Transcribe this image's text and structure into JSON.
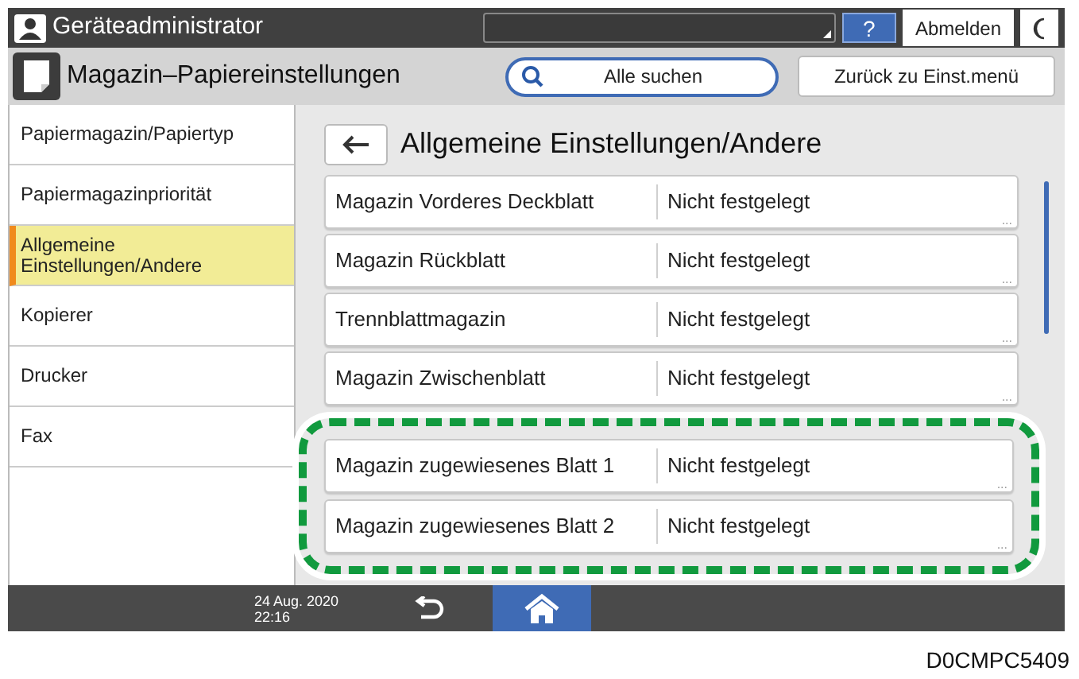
{
  "top_bar": {
    "user": "Geräteadministrator",
    "help": "?",
    "logout": "Abmelden"
  },
  "header": {
    "title": "Magazin–Papiereinstellungen",
    "search": "Alle suchen",
    "back_button": "Zurück zu Einst.menü"
  },
  "sidebar": {
    "items": [
      {
        "label": "Papiermagazin/Papiertyp",
        "selected": false
      },
      {
        "label": "Papiermagazinpriorität",
        "selected": false
      },
      {
        "label": "Allgemeine Einstellungen/Andere",
        "selected": true
      },
      {
        "label": "Kopierer",
        "selected": false
      },
      {
        "label": "Drucker",
        "selected": false
      },
      {
        "label": "Fax",
        "selected": false
      }
    ]
  },
  "panel": {
    "title": "Allgemeine Einstellungen/Andere",
    "rows": [
      {
        "label": "Magazin Vorderes Deckblatt",
        "value": "Nicht festgelegt",
        "more": "...",
        "highlighted": false
      },
      {
        "label": "Magazin Rückblatt",
        "value": "Nicht festgelegt",
        "more": "...",
        "highlighted": false
      },
      {
        "label": "Trennblattmagazin",
        "value": "Nicht festgelegt",
        "more": "...",
        "highlighted": false
      },
      {
        "label": "Magazin Zwischenblatt",
        "value": "Nicht festgelegt",
        "more": "...",
        "highlighted": false
      },
      {
        "label": "Magazin zugewiesenes Blatt 1",
        "value": "Nicht festgelegt",
        "more": "...",
        "highlighted": true
      },
      {
        "label": "Magazin zugewiesenes Blatt 2",
        "value": "Nicht festgelegt",
        "more": "...",
        "highlighted": true
      }
    ]
  },
  "bottom_bar": {
    "date": "24 Aug. 2020",
    "time": "22:16"
  },
  "figure_code": "D0CMPC5409"
}
